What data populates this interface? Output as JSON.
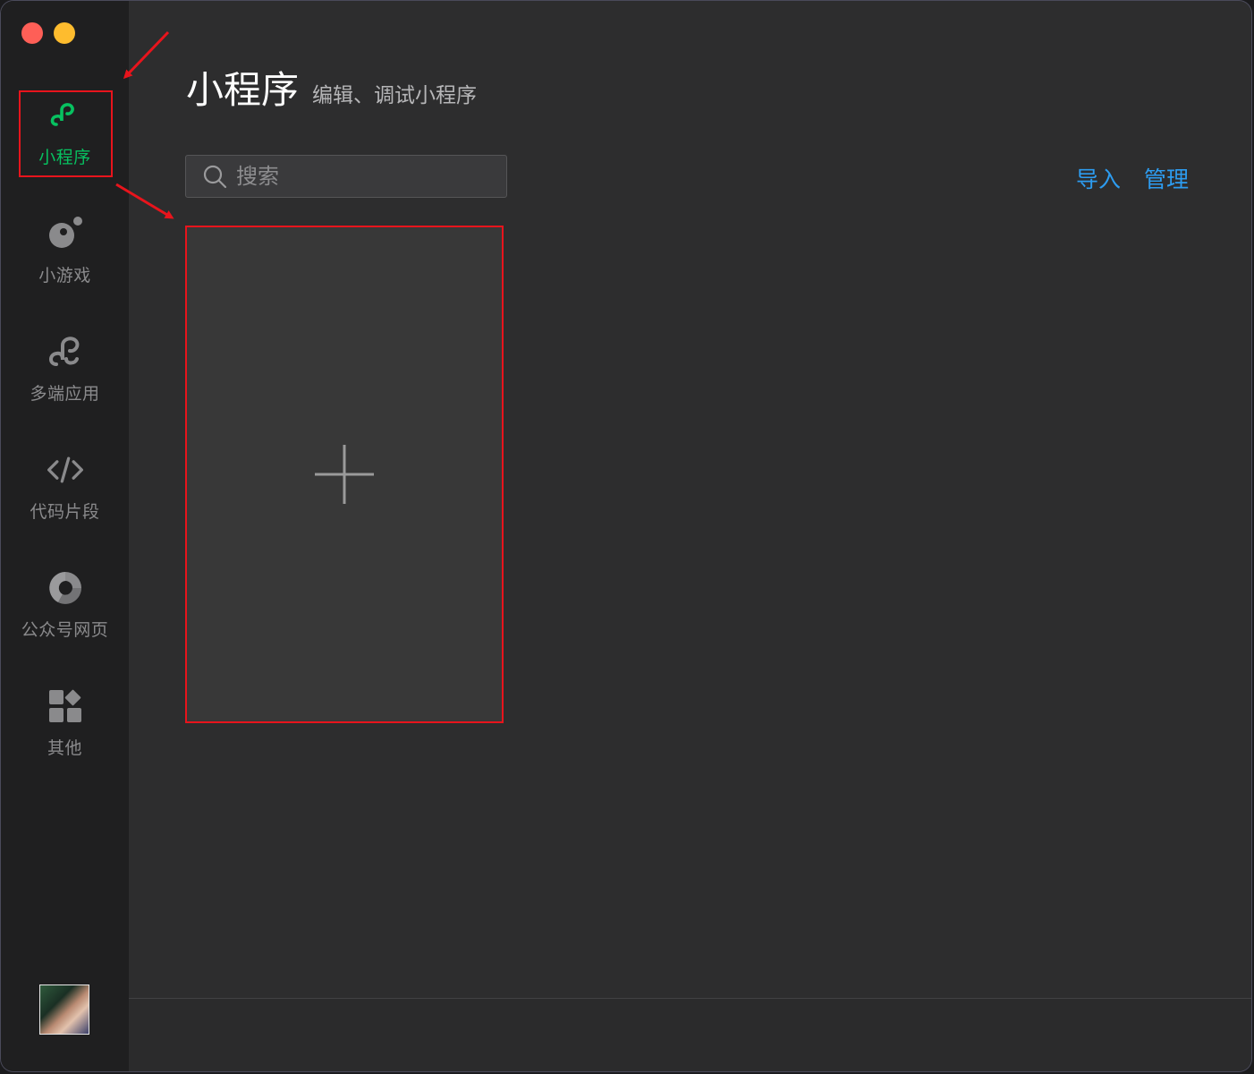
{
  "sidebar": {
    "items": [
      {
        "label": "小程序",
        "icon": "miniprogram-icon",
        "active": true
      },
      {
        "label": "小游戏",
        "icon": "minigame-icon",
        "active": false
      },
      {
        "label": "多端应用",
        "icon": "multiplatform-icon",
        "active": false
      },
      {
        "label": "代码片段",
        "icon": "code-icon",
        "active": false
      },
      {
        "label": "公众号网页",
        "icon": "webpage-icon",
        "active": false
      },
      {
        "label": "其他",
        "icon": "grid-icon",
        "active": false
      }
    ],
    "active_color": "#07c160",
    "avatar": "user-avatar"
  },
  "header": {
    "title": "小程序",
    "subtitle": "编辑、调试小程序"
  },
  "search": {
    "placeholder": "搜索",
    "value": ""
  },
  "actions": {
    "import_label": "导入",
    "manage_label": "管理",
    "link_color": "#2d9cf0"
  },
  "project_grid": {
    "add_card_icon": "plus-icon"
  },
  "annotations": {
    "highlight_color": "#e8141c"
  }
}
